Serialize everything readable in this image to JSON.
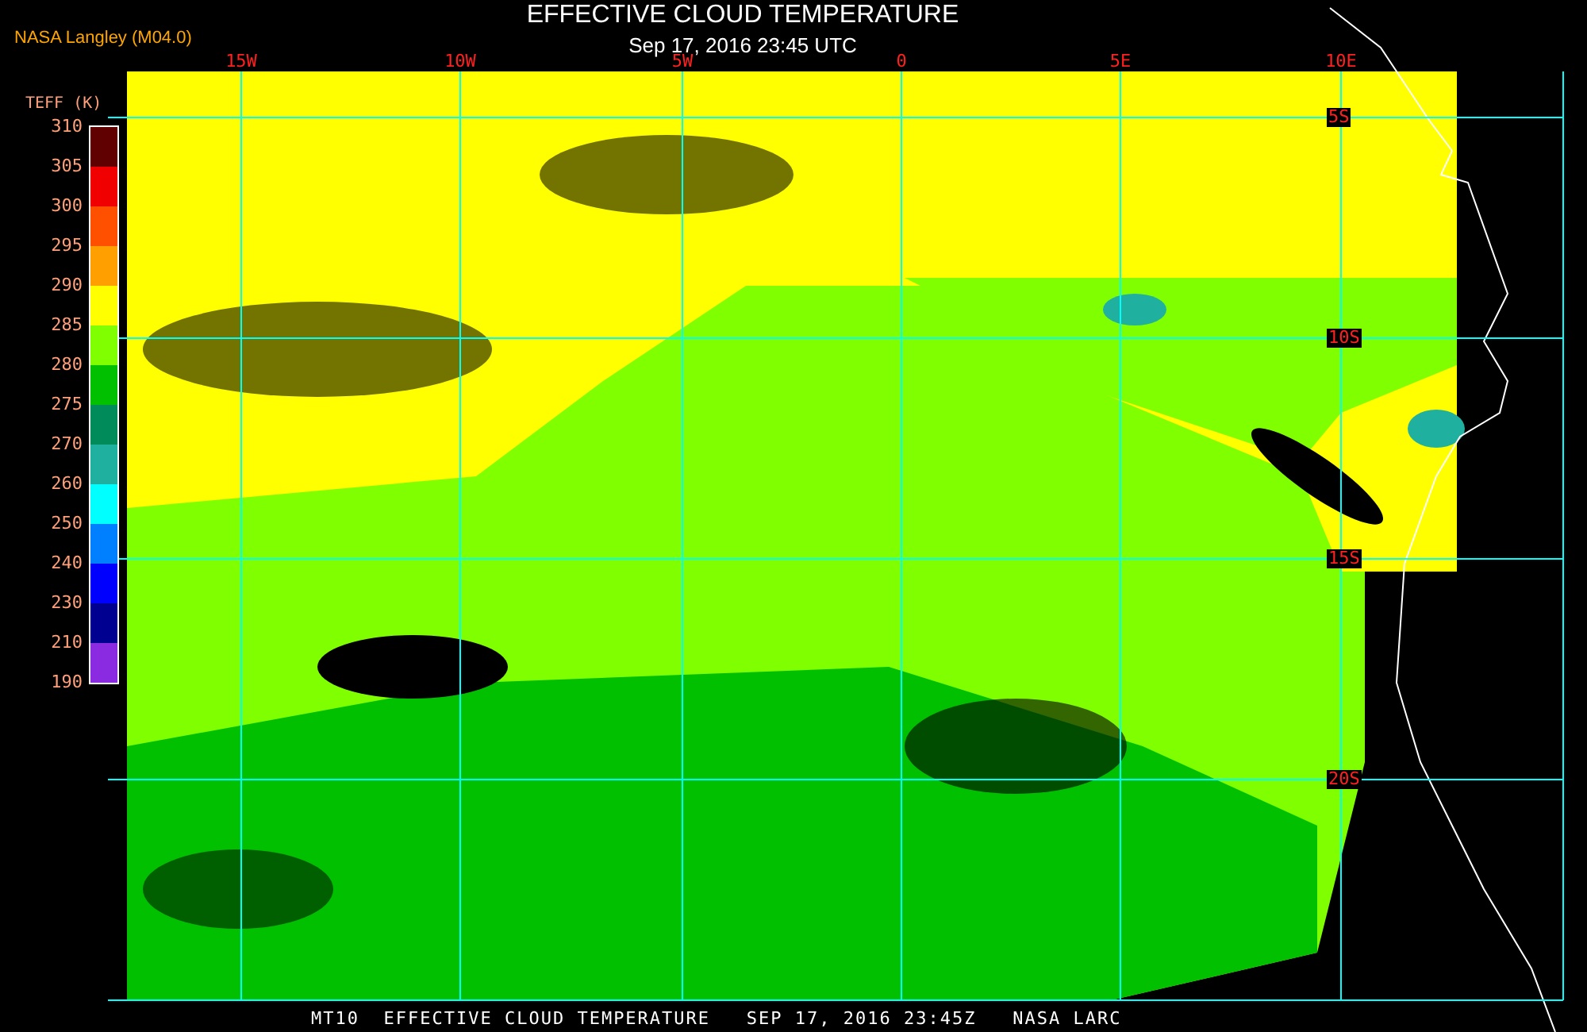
{
  "source": "NASA Langley (M04.0)",
  "title": "EFFECTIVE CLOUD TEMPERATURE",
  "subtitle": "Sep 17, 2016 23:45 UTC",
  "legend": {
    "title": "TEFF (K)",
    "bands": [
      {
        "color": "#600000"
      },
      {
        "color": "#f00000"
      },
      {
        "color": "#ff5000"
      },
      {
        "color": "#ffa000"
      },
      {
        "color": "#ffff00"
      },
      {
        "color": "#80ff00"
      },
      {
        "color": "#00c000"
      },
      {
        "color": "#008c5a"
      },
      {
        "color": "#20b0a0"
      },
      {
        "color": "#00ffff"
      },
      {
        "color": "#0080ff"
      },
      {
        "color": "#0000ff"
      },
      {
        "color": "#000090"
      },
      {
        "color": "#8a2be2"
      }
    ],
    "ticks": [
      "310",
      "305",
      "300",
      "295",
      "290",
      "285",
      "280",
      "275",
      "270",
      "260",
      "250",
      "240",
      "230",
      "210",
      "190"
    ]
  },
  "map": {
    "lon_labels": [
      "15W",
      "10W",
      "5W",
      "0",
      "5E",
      "10E"
    ],
    "lat_labels": [
      "5S",
      "10S",
      "15S",
      "20S"
    ]
  },
  "footer": "MT10  EFFECTIVE CLOUD TEMPERATURE   SEP 17, 2016 23:45Z   NASA LARC"
}
